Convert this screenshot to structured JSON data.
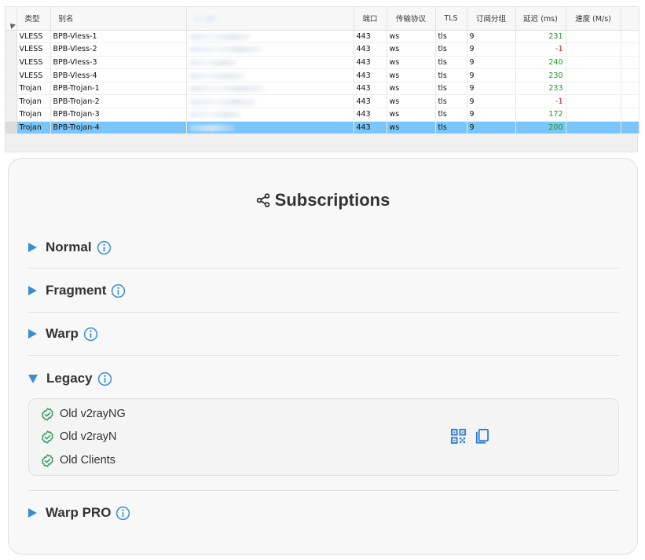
{
  "table": {
    "headers": [
      "类型",
      "别名",
      "地址",
      "端口",
      "传输协议",
      "TLS",
      "订阅分组",
      "延迟 (ms)",
      "速度 (M/s)"
    ],
    "rows": [
      {
        "type": "VLESS",
        "alias": "BPB-Vless-1",
        "port": "443",
        "network": "ws",
        "tls": "tls",
        "group": "9",
        "latency": "231"
      },
      {
        "type": "VLESS",
        "alias": "BPB-Vless-2",
        "port": "443",
        "network": "ws",
        "tls": "tls",
        "group": "9",
        "latency": "-1"
      },
      {
        "type": "VLESS",
        "alias": "BPB-Vless-3",
        "port": "443",
        "network": "ws",
        "tls": "tls",
        "group": "9",
        "latency": "240"
      },
      {
        "type": "VLESS",
        "alias": "BPB-Vless-4",
        "port": "443",
        "network": "ws",
        "tls": "tls",
        "group": "9",
        "latency": "230"
      },
      {
        "type": "Trojan",
        "alias": "BPB-Trojan-1",
        "port": "443",
        "network": "ws",
        "tls": "tls",
        "group": "9",
        "latency": "233"
      },
      {
        "type": "Trojan",
        "alias": "BPB-Trojan-2",
        "port": "443",
        "network": "ws",
        "tls": "tls",
        "group": "9",
        "latency": "-1"
      },
      {
        "type": "Trojan",
        "alias": "BPB-Trojan-3",
        "port": "443",
        "network": "ws",
        "tls": "tls",
        "group": "9",
        "latency": "172"
      },
      {
        "type": "Trojan",
        "alias": "BPB-Trojan-4",
        "port": "443",
        "network": "ws",
        "tls": "tls",
        "group": "9",
        "latency": "200"
      }
    ],
    "selected_index": 7,
    "colors": {
      "positive": "#1a9a1a",
      "negative": "#e02020",
      "selection": "#7bc6f8"
    }
  },
  "subscriptions": {
    "title": "Subscriptions",
    "title_icon": "share-icon",
    "accent": "#3a8ed6",
    "sections": [
      {
        "label": "Normal",
        "expanded": false
      },
      {
        "label": "Fragment",
        "expanded": false
      },
      {
        "label": "Warp",
        "expanded": false
      },
      {
        "label": "Legacy",
        "expanded": true
      },
      {
        "label": "Warp PRO",
        "expanded": false
      }
    ],
    "legacy_items": [
      "Old v2rayNG",
      "Old v2rayN",
      "Old Clients"
    ],
    "legacy_actions": [
      "qr-code-icon",
      "copy-icon"
    ]
  }
}
